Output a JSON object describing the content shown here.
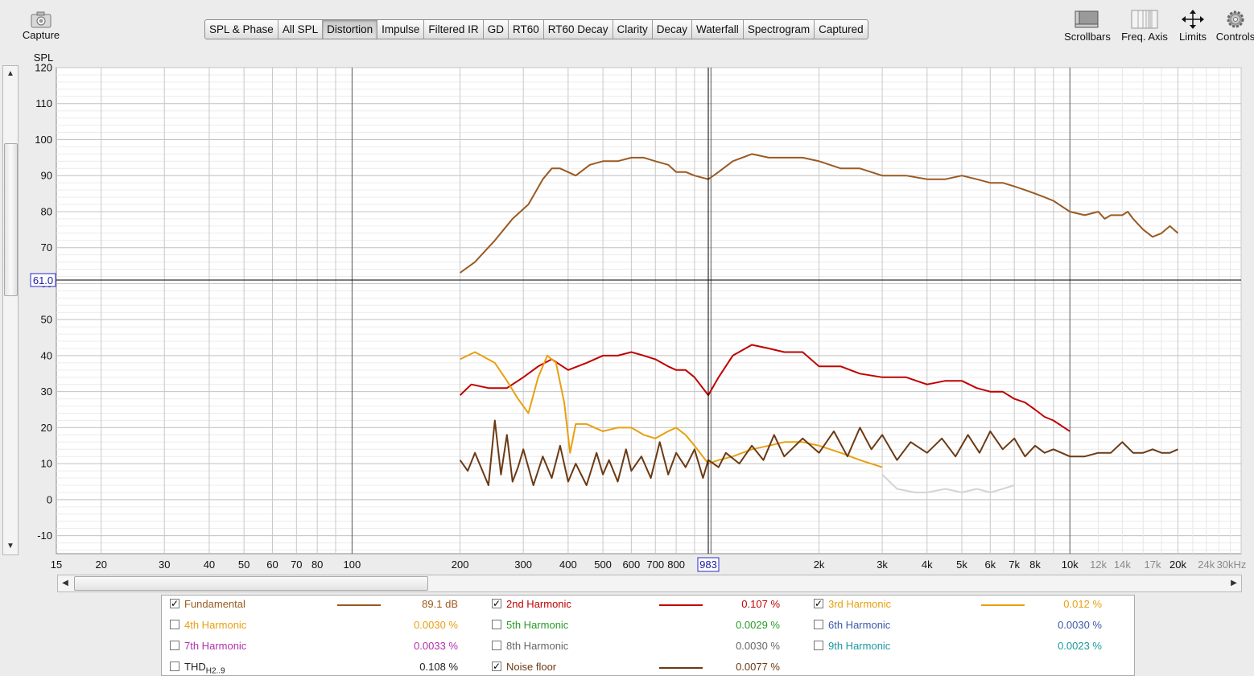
{
  "toolbar": {
    "capture_label": "Capture",
    "tabs": [
      "SPL & Phase",
      "All SPL",
      "Distortion",
      "Impulse",
      "Filtered IR",
      "GD",
      "RT60",
      "RT60 Decay",
      "Clarity",
      "Decay",
      "Waterfall",
      "Spectrogram",
      "Captured"
    ],
    "active_tab": "Distortion",
    "right": {
      "scrollbars_label": "Scrollbars",
      "freq_axis_label": "Freq. Axis",
      "limits_label": "Limits",
      "controls_label": "Controls"
    }
  },
  "graph": {
    "y_unit": "SPL",
    "x_unit": "Hz",
    "cursor": {
      "spl_label": "61.0",
      "freq_label": "983",
      "spl": 61,
      "freq": 983
    }
  },
  "chart_data": {
    "type": "line",
    "xlabel": "Hz",
    "ylabel": "SPL",
    "x_scale": "log",
    "xlim": [
      15,
      30000
    ],
    "ylim": [
      -15,
      120
    ],
    "y_ticks": [
      120,
      110,
      100,
      90,
      80,
      70,
      60,
      50,
      40,
      30,
      20,
      10,
      0,
      -10
    ],
    "x_ticks": [
      {
        "v": 15,
        "label": "15"
      },
      {
        "v": 20,
        "label": "20"
      },
      {
        "v": 30,
        "label": "30"
      },
      {
        "v": 40,
        "label": "40"
      },
      {
        "v": 50,
        "label": "50"
      },
      {
        "v": 60,
        "label": "60"
      },
      {
        "v": 70,
        "label": "70"
      },
      {
        "v": 80,
        "label": "80"
      },
      {
        "v": 100,
        "label": "100"
      },
      {
        "v": 200,
        "label": "200"
      },
      {
        "v": 300,
        "label": "300"
      },
      {
        "v": 400,
        "label": "400"
      },
      {
        "v": 500,
        "label": "500"
      },
      {
        "v": 600,
        "label": "600"
      },
      {
        "v": 700,
        "label": "700"
      },
      {
        "v": 800,
        "label": "800"
      },
      {
        "v": 2000,
        "label": "2k"
      },
      {
        "v": 3000,
        "label": "3k"
      },
      {
        "v": 4000,
        "label": "4k"
      },
      {
        "v": 5000,
        "label": "5k"
      },
      {
        "v": 6000,
        "label": "6k"
      },
      {
        "v": 7000,
        "label": "7k"
      },
      {
        "v": 8000,
        "label": "8k"
      },
      {
        "v": 10000,
        "label": "10k"
      },
      {
        "v": 12000,
        "label": "12k"
      },
      {
        "v": 14000,
        "label": "14k"
      },
      {
        "v": 17000,
        "label": "17k"
      },
      {
        "v": 20000,
        "label": "20k"
      },
      {
        "v": 24000,
        "label": "24k"
      },
      {
        "v": 30000,
        "label": "30kHz"
      }
    ],
    "grid": true,
    "series": [
      {
        "name": "Fundamental",
        "color": "#9a5a22",
        "x": [
          200,
          220,
          250,
          280,
          310,
          340,
          360,
          380,
          420,
          460,
          500,
          550,
          600,
          650,
          700,
          760,
          800,
          850,
          900,
          983,
          1050,
          1150,
          1300,
          1450,
          1600,
          1800,
          2000,
          2300,
          2600,
          3000,
          3500,
          4000,
          4500,
          5000,
          5500,
          6000,
          6500,
          7000,
          7500,
          8000,
          8500,
          9000,
          10000,
          11000,
          12000,
          12500,
          13000,
          14000,
          14500,
          15000,
          16000,
          17000,
          18000,
          19000,
          20000
        ],
        "y": [
          63,
          66,
          72,
          78,
          82,
          89,
          92,
          92,
          90,
          93,
          94,
          94,
          95,
          95,
          94,
          93,
          91,
          91,
          90,
          89,
          91,
          94,
          96,
          95,
          95,
          95,
          94,
          92,
          92,
          90,
          90,
          89,
          89,
          90,
          89,
          88,
          88,
          87,
          86,
          85,
          84,
          83,
          80,
          79,
          80,
          78,
          79,
          79,
          80,
          78,
          75,
          73,
          74,
          76,
          74
        ]
      },
      {
        "name": "2nd Harmonic",
        "color": "#c00000",
        "x": [
          200,
          215,
          240,
          270,
          300,
          330,
          360,
          400,
          450,
          500,
          550,
          600,
          650,
          700,
          760,
          800,
          850,
          900,
          983,
          1050,
          1150,
          1300,
          1450,
          1600,
          1800,
          2000,
          2300,
          2600,
          3000,
          3500,
          4000,
          4500,
          5000,
          5500,
          6000,
          6500,
          7000,
          7500,
          8000,
          8500,
          9000,
          10000
        ],
        "y": [
          29,
          32,
          31,
          31,
          34,
          37,
          39,
          36,
          38,
          40,
          40,
          41,
          40,
          39,
          37,
          36,
          36,
          34,
          29,
          34,
          40,
          43,
          42,
          41,
          41,
          37,
          37,
          35,
          34,
          34,
          32,
          33,
          33,
          31,
          30,
          30,
          28,
          27,
          25,
          23,
          22,
          19
        ]
      },
      {
        "name": "3rd Harmonic",
        "color": "#e8a010",
        "x": [
          200,
          220,
          250,
          270,
          290,
          310,
          330,
          350,
          370,
          390,
          405,
          420,
          450,
          500,
          550,
          600,
          650,
          700,
          760,
          800,
          850,
          900,
          983,
          1050,
          1150,
          1300,
          1450,
          1600,
          1800,
          2000,
          2300,
          2600,
          3000
        ],
        "y": [
          39,
          41,
          38,
          33,
          28,
          24,
          34,
          40,
          38,
          27,
          13,
          21,
          21,
          19,
          20,
          20,
          18,
          17,
          19,
          20,
          18,
          15,
          10,
          11,
          12,
          14,
          15,
          16,
          16,
          15,
          13,
          11,
          9
        ]
      },
      {
        "name": "THD H2..9",
        "color": "#d4d4d4",
        "x": [
          3000,
          3300,
          3700,
          4000,
          4500,
          5000,
          5500,
          6000,
          6500,
          7000
        ],
        "y": [
          7,
          3,
          2,
          2,
          3,
          2,
          3,
          2,
          3,
          4
        ]
      },
      {
        "name": "Noise floor",
        "color": "#6b3a14",
        "x": [
          200,
          210,
          220,
          240,
          250,
          260,
          270,
          280,
          290,
          300,
          320,
          340,
          360,
          380,
          400,
          420,
          450,
          480,
          500,
          520,
          550,
          580,
          600,
          640,
          680,
          720,
          760,
          800,
          850,
          900,
          950,
          983,
          1050,
          1100,
          1200,
          1300,
          1400,
          1500,
          1600,
          1800,
          2000,
          2200,
          2400,
          2600,
          2800,
          3000,
          3300,
          3600,
          4000,
          4400,
          4800,
          5200,
          5600,
          6000,
          6500,
          7000,
          7500,
          8000,
          8500,
          9000,
          10000,
          11000,
          12000,
          13000,
          14000,
          15000,
          16000,
          17000,
          18000,
          19000,
          20000
        ],
        "y": [
          11,
          8,
          13,
          4,
          22,
          7,
          18,
          5,
          9,
          14,
          4,
          12,
          6,
          15,
          5,
          10,
          4,
          13,
          7,
          11,
          5,
          14,
          8,
          12,
          6,
          16,
          7,
          13,
          9,
          14,
          6,
          11,
          9,
          13,
          10,
          15,
          11,
          18,
          12,
          17,
          13,
          19,
          12,
          20,
          14,
          18,
          11,
          16,
          13,
          17,
          12,
          18,
          13,
          19,
          14,
          17,
          12,
          15,
          13,
          14,
          12,
          12,
          13,
          13,
          16,
          13,
          13,
          14,
          13,
          13,
          14
        ]
      }
    ]
  },
  "legend": {
    "rows": [
      [
        {
          "label": "Fundamental",
          "checked": true,
          "color": "#9a5a22",
          "value": "89.1 dB",
          "line": true
        },
        {
          "label": "2nd Harmonic",
          "checked": true,
          "color": "#c00000",
          "value": "0.107 %",
          "line": true
        },
        {
          "label": "3rd Harmonic",
          "checked": true,
          "color": "#e8a010",
          "value": "0.012 %",
          "line": true
        }
      ],
      [
        {
          "label": "4th Harmonic",
          "checked": false,
          "color": "#e8a010",
          "value": "0.0030 %",
          "line": false
        },
        {
          "label": "5th Harmonic",
          "checked": false,
          "color": "#2a9a2a",
          "value": "0.0029 %",
          "line": false
        },
        {
          "label": "6th Harmonic",
          "checked": false,
          "color": "#3a5aa8",
          "value": "0.0030 %",
          "line": false
        }
      ],
      [
        {
          "label": "7th Harmonic",
          "checked": false,
          "color": "#b030b0",
          "value": "0.0033 %",
          "line": false
        },
        {
          "label": "8th Harmonic",
          "checked": false,
          "color": "#666666",
          "value": "0.0030 %",
          "line": false
        },
        {
          "label": "9th Harmonic",
          "checked": false,
          "color": "#1a9aa0",
          "value": "0.0023 %",
          "line": false
        }
      ],
      [
        {
          "label": "THD",
          "sub": "H2..9",
          "checked": false,
          "color": "#222222",
          "value": "0.108 %",
          "line": false
        },
        {
          "label": "Noise floor",
          "checked": true,
          "color": "#6b3a14",
          "value": "0.0077 %",
          "line": true
        }
      ]
    ]
  }
}
